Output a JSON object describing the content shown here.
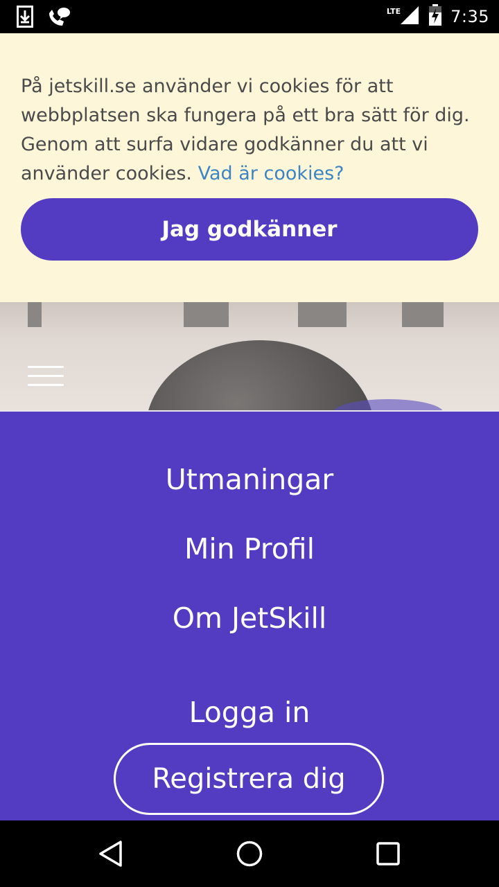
{
  "status_bar": {
    "time": "7:35",
    "network": "LTE",
    "icons": [
      "download-icon",
      "voicemail-icon",
      "signal-icon",
      "battery-charging-icon"
    ]
  },
  "cookie_banner": {
    "text": "På jetskill.se använder vi cookies för att webbplatsen ska fungera på ett bra sätt för dig. Genom att surfa vidare godkänner du att vi använder cookies.",
    "link_label": "Vad är cookies?",
    "accept_label": "Jag godkänner",
    "background_color": "#fdf6d9",
    "link_color": "#3e84c0"
  },
  "menu": {
    "toggle_icon": "hamburger-menu-icon",
    "items": [
      {
        "label": "Utmaningar"
      },
      {
        "label": "Min Profil"
      },
      {
        "label": "Om JetSkill"
      }
    ],
    "login_label": "Logga in",
    "register_label": "Registrera dig",
    "background_color": "#543cc2"
  },
  "android_nav": {
    "icons": [
      "back-icon",
      "home-icon",
      "recents-icon"
    ]
  },
  "colors": {
    "accent": "#543cc2",
    "text_on_accent": "#ffffff"
  }
}
